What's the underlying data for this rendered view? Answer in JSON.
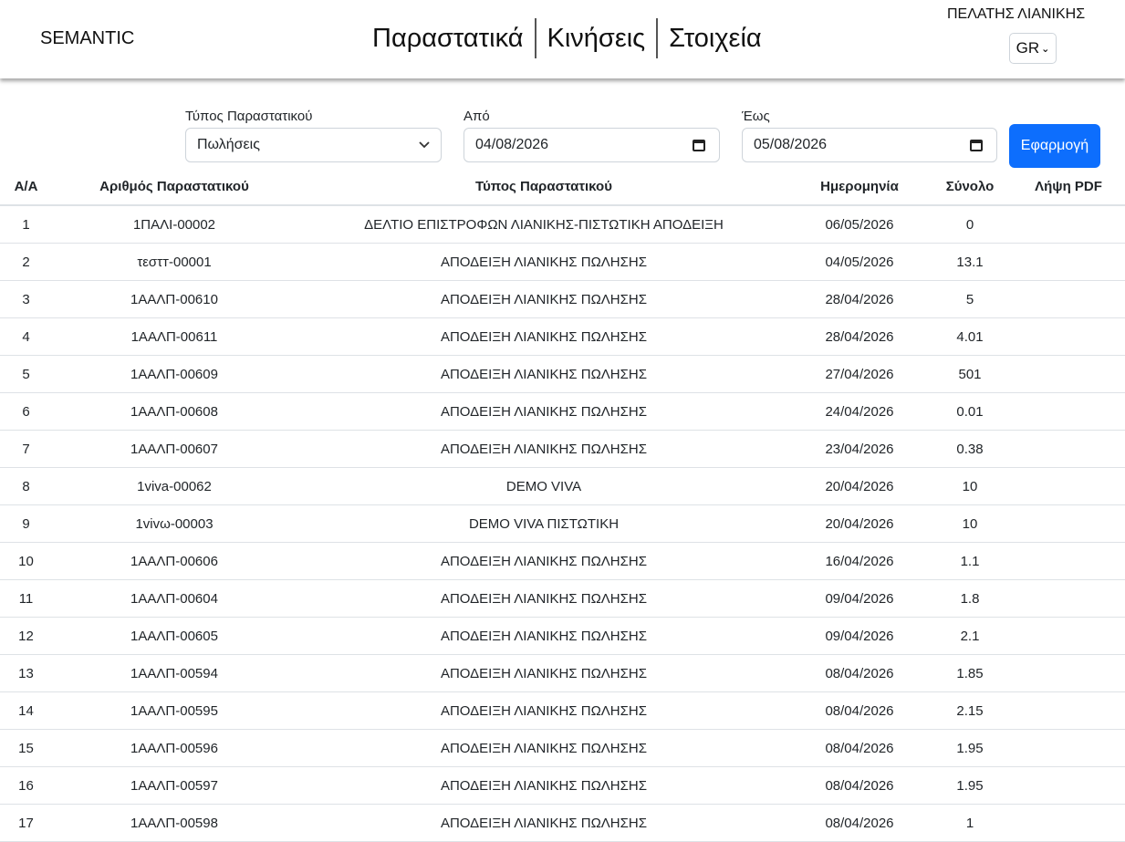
{
  "header": {
    "brand": "SEMANTIC",
    "nav": [
      "Παραστατικά",
      "Κινήσεις",
      "Στοιχεία"
    ],
    "customer": "ΠΕΛΑΤΗΣ ΛΙΑΝΙΚΗΣ",
    "language": "GR"
  },
  "filters": {
    "type_label": "Τύπος Παραστατικού",
    "type_value": "Πωλήσεις",
    "from_label": "Από",
    "from_value": "04/08/2026",
    "to_label": "Έως",
    "to_value": "05/08/2026",
    "apply_label": "Εφαρμογή"
  },
  "table": {
    "columns": [
      "Α/Α",
      "Αριθμός Παραστατικού",
      "Τύπος Παραστατικού",
      "Ημερομηνία",
      "Σύνολο",
      "Λήψη PDF"
    ],
    "rows": [
      [
        "1",
        "1ΠΑΛΙ-00002",
        "ΔΕΛΤΙΟ ΕΠΙΣΤΡΟΦΩΝ ΛΙΑΝΙΚΗΣ-ΠΙΣΤΩΤΙΚΗ ΑΠΟΔΕΙΞΗ",
        "06/05/2026",
        "0",
        ""
      ],
      [
        "2",
        "τεστт-00001",
        "ΑΠΟΔΕΙΞΗ ΛΙΑΝΙΚΗΣ ΠΩΛΗΣΗΣ",
        "04/05/2026",
        "13.1",
        ""
      ],
      [
        "3",
        "1ΑΑΛΠ-00610",
        "ΑΠΟΔΕΙΞΗ ΛΙΑΝΙΚΗΣ ΠΩΛΗΣΗΣ",
        "28/04/2026",
        "5",
        ""
      ],
      [
        "4",
        "1ΑΑΛΠ-00611",
        "ΑΠΟΔΕΙΞΗ ΛΙΑΝΙΚΗΣ ΠΩΛΗΣΗΣ",
        "28/04/2026",
        "4.01",
        ""
      ],
      [
        "5",
        "1ΑΑΛΠ-00609",
        "ΑΠΟΔΕΙΞΗ ΛΙΑΝΙΚΗΣ ΠΩΛΗΣΗΣ",
        "27/04/2026",
        "501",
        ""
      ],
      [
        "6",
        "1ΑΑΛΠ-00608",
        "ΑΠΟΔΕΙΞΗ ΛΙΑΝΙΚΗΣ ΠΩΛΗΣΗΣ",
        "24/04/2026",
        "0.01",
        ""
      ],
      [
        "7",
        "1ΑΑΛΠ-00607",
        "ΑΠΟΔΕΙΞΗ ΛΙΑΝΙΚΗΣ ΠΩΛΗΣΗΣ",
        "23/04/2026",
        "0.38",
        ""
      ],
      [
        "8",
        "1viva-00062",
        "DEMO VIVA",
        "20/04/2026",
        "10",
        ""
      ],
      [
        "9",
        "1vivω-00003",
        "DEMO VIVA ΠΙΣΤΩΤΙΚΗ",
        "20/04/2026",
        "10",
        ""
      ],
      [
        "10",
        "1ΑΑΛΠ-00606",
        "ΑΠΟΔΕΙΞΗ ΛΙΑΝΙΚΗΣ ΠΩΛΗΣΗΣ",
        "16/04/2026",
        "1.1",
        ""
      ],
      [
        "11",
        "1ΑΑΛΠ-00604",
        "ΑΠΟΔΕΙΞΗ ΛΙΑΝΙΚΗΣ ΠΩΛΗΣΗΣ",
        "09/04/2026",
        "1.8",
        ""
      ],
      [
        "12",
        "1ΑΑΛΠ-00605",
        "ΑΠΟΔΕΙΞΗ ΛΙΑΝΙΚΗΣ ΠΩΛΗΣΗΣ",
        "09/04/2026",
        "2.1",
        ""
      ],
      [
        "13",
        "1ΑΑΛΠ-00594",
        "ΑΠΟΔΕΙΞΗ ΛΙΑΝΙΚΗΣ ΠΩΛΗΣΗΣ",
        "08/04/2026",
        "1.85",
        ""
      ],
      [
        "14",
        "1ΑΑΛΠ-00595",
        "ΑΠΟΔΕΙΞΗ ΛΙΑΝΙΚΗΣ ΠΩΛΗΣΗΣ",
        "08/04/2026",
        "2.15",
        ""
      ],
      [
        "15",
        "1ΑΑΛΠ-00596",
        "ΑΠΟΔΕΙΞΗ ΛΙΑΝΙΚΗΣ ΠΩΛΗΣΗΣ",
        "08/04/2026",
        "1.95",
        ""
      ],
      [
        "16",
        "1ΑΑΛΠ-00597",
        "ΑΠΟΔΕΙΞΗ ΛΙΑΝΙΚΗΣ ΠΩΛΗΣΗΣ",
        "08/04/2026",
        "1.95",
        ""
      ],
      [
        "17",
        "1ΑΑΛΠ-00598",
        "ΑΠΟΔΕΙΞΗ ΛΙΑΝΙΚΗΣ ΠΩΛΗΣΗΣ",
        "08/04/2026",
        "1",
        ""
      ]
    ]
  },
  "colors": {
    "primary": "#0d6efd",
    "border": "#dee2e6"
  }
}
